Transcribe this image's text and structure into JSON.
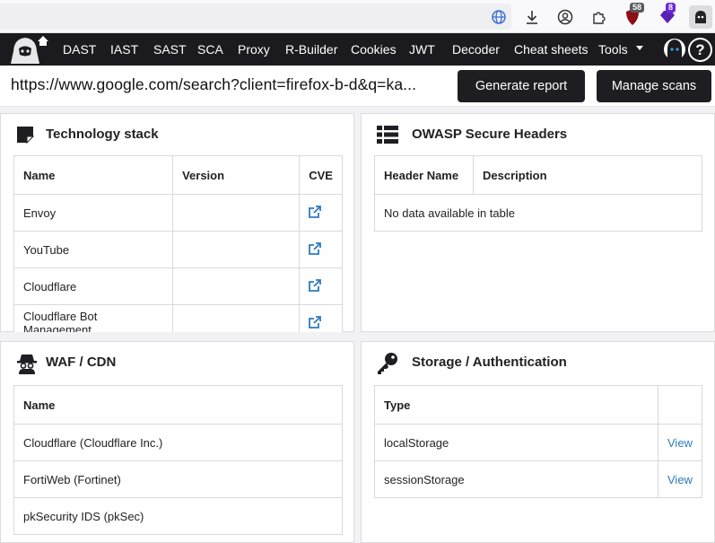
{
  "browser": {
    "badge_left": "58",
    "badge_right": "8"
  },
  "nav": {
    "items": [
      "DAST",
      "IAST",
      "SAST",
      "SCA",
      "Proxy",
      "R-Builder",
      "Cookies",
      "JWT",
      "Decoder",
      "Cheat sheets",
      "Tools"
    ]
  },
  "url_bar": {
    "url": "https://www.google.com/search?client=firefox-b-d&q=ka...",
    "generate_report": "Generate report",
    "manage_scans": "Manage scans"
  },
  "tech_stack": {
    "title": "Technology stack",
    "columns": [
      "Name",
      "Version",
      "CVE"
    ],
    "rows": [
      {
        "name": "Envoy",
        "version": ""
      },
      {
        "name": "YouTube",
        "version": ""
      },
      {
        "name": "Cloudflare",
        "version": ""
      },
      {
        "name": "Cloudflare Bot Management",
        "version": ""
      }
    ]
  },
  "owasp": {
    "title": "OWASP Secure Headers",
    "columns": [
      "Header Name",
      "Description"
    ],
    "empty": "No data available in table"
  },
  "waf": {
    "title": "WAF / CDN",
    "columns": [
      "Name"
    ],
    "rows": [
      "Cloudflare (Cloudflare Inc.)",
      "FortiWeb (Fortinet)",
      "pkSecurity IDS (pkSec)"
    ]
  },
  "storage": {
    "title": "Storage / Authentication",
    "columns": [
      "Type",
      ""
    ],
    "rows": [
      {
        "type": "localStorage",
        "action": "View"
      },
      {
        "type": "sessionStorage",
        "action": "View"
      }
    ]
  },
  "colors": {
    "nav_bg": "#1b1b1f",
    "button_bg": "#1e1e22",
    "link": "#2b7bbd"
  }
}
